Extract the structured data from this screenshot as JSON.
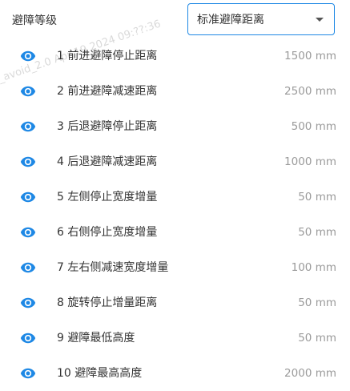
{
  "header": {
    "title": "避障等级",
    "select_value": "标准避障距离"
  },
  "watermark": "_avoid_2.0 Apr 19 2024 09:??:36",
  "colors": {
    "accent": "#1e88e5",
    "value_text": "#9a9a9a"
  },
  "params": [
    {
      "label": "1 前进避障停止距离",
      "value": "1500 mm",
      "icon": "eye-icon"
    },
    {
      "label": "2 前进避障减速距离",
      "value": "2500 mm",
      "icon": "eye-icon"
    },
    {
      "label": "3 后退避障停止距离",
      "value": "500 mm",
      "icon": "eye-icon"
    },
    {
      "label": "4 后退避障减速距离",
      "value": "1000 mm",
      "icon": "eye-icon"
    },
    {
      "label": "5 左侧停止宽度增量",
      "value": "50 mm",
      "icon": "eye-icon"
    },
    {
      "label": "6 右侧停止宽度增量",
      "value": "50 mm",
      "icon": "eye-icon"
    },
    {
      "label": "7 左右侧减速宽度增量",
      "value": "100 mm",
      "icon": "eye-icon"
    },
    {
      "label": "8 旋转停止增量距离",
      "value": "50 mm",
      "icon": "eye-icon"
    },
    {
      "label": "9 避障最低高度",
      "value": "50 mm",
      "icon": "eye-icon"
    },
    {
      "label": "10 避障最高高度",
      "value": "2000 mm",
      "icon": "eye-icon"
    }
  ]
}
